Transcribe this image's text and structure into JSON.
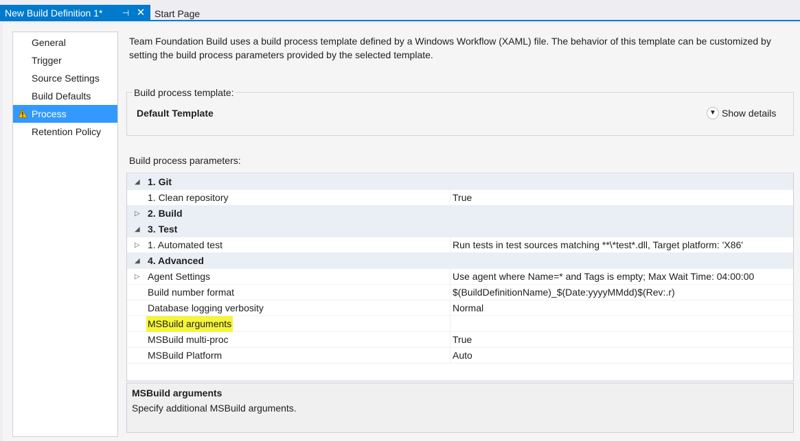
{
  "tabs": {
    "active": {
      "title": "New Build Definition 1*",
      "pin_glyph": "⊣",
      "close_glyph": "✕"
    },
    "inactive": {
      "title": "Start Page"
    }
  },
  "colors": {
    "accent": "#007acc",
    "selection": "#3399ff",
    "highlight": "#f5f53a",
    "warning": "#f0c000"
  },
  "nav": {
    "items": [
      {
        "label": "General"
      },
      {
        "label": "Trigger"
      },
      {
        "label": "Source Settings"
      },
      {
        "label": "Build Defaults"
      },
      {
        "label": "Process",
        "selected": true,
        "icon": "warning-icon"
      },
      {
        "label": "Retention Policy"
      }
    ]
  },
  "intro": {
    "text": "Team Foundation Build uses a build process template defined by a Windows Workflow (XAML) file. The behavior of this template can be customized by setting the build process parameters provided by the selected template."
  },
  "template": {
    "group_label": "Build process template:",
    "name": "Default Template",
    "show_details_label": "Show details",
    "show_details_icon": "chevron-down-icon"
  },
  "params": {
    "label": "Build process parameters:",
    "rows": [
      {
        "type": "category",
        "expander": "◢",
        "label": "1. Git"
      },
      {
        "type": "property",
        "expander": "",
        "label": "1. Clean repository",
        "value": "True"
      },
      {
        "type": "category",
        "expander": "▷",
        "label": "2. Build"
      },
      {
        "type": "category",
        "expander": "◢",
        "label": "3. Test"
      },
      {
        "type": "property",
        "expander": "▷",
        "label": "1. Automated test",
        "value": "Run tests in test sources matching **\\*test*.dll, Target platform: 'X86'"
      },
      {
        "type": "category",
        "expander": "◢",
        "label": "4. Advanced"
      },
      {
        "type": "property",
        "expander": "▷",
        "label": "Agent Settings",
        "value": "Use agent where Name=* and Tags is empty; Max Wait Time: 04:00:00"
      },
      {
        "type": "property",
        "expander": "",
        "label": "Build number format",
        "value": "$(BuildDefinitionName)_$(Date:yyyyMMdd)$(Rev:.r)"
      },
      {
        "type": "property",
        "expander": "",
        "label": "Database logging verbosity",
        "value": "Normal"
      },
      {
        "type": "property",
        "expander": "",
        "label": "MSBuild arguments",
        "value": "",
        "highlighted": true
      },
      {
        "type": "property",
        "expander": "",
        "label": "MSBuild multi-proc",
        "value": "True"
      },
      {
        "type": "property",
        "expander": "",
        "label": "MSBuild Platform",
        "value": "Auto"
      }
    ]
  },
  "help": {
    "title": "MSBuild arguments",
    "text": "Specify additional MSBuild arguments."
  }
}
